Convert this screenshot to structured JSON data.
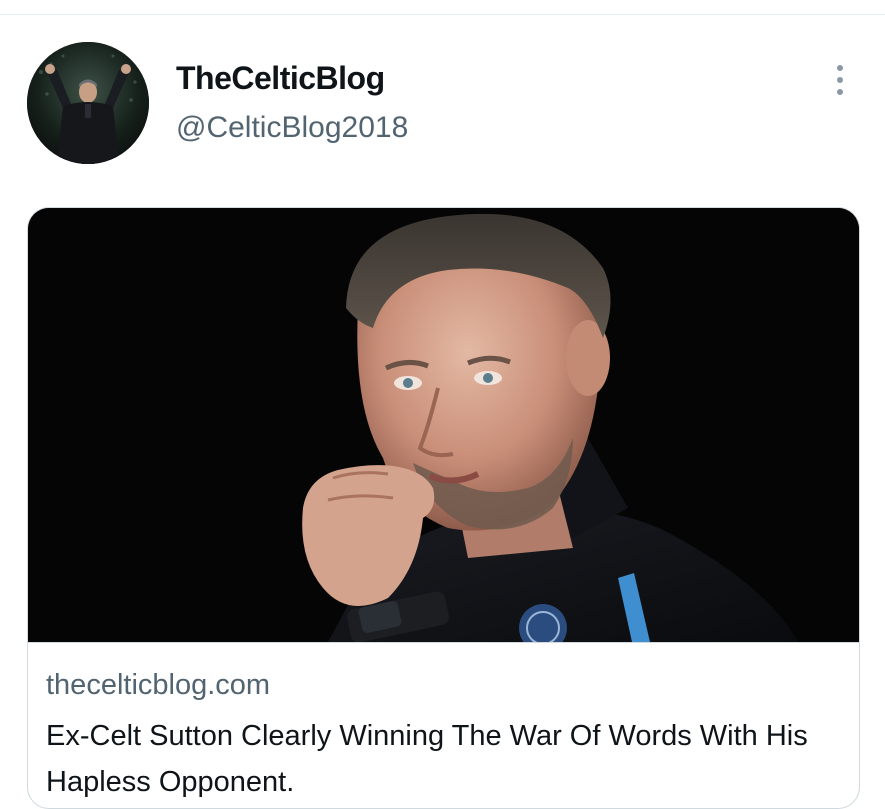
{
  "tweet": {
    "author": {
      "display_name": "TheCelticBlog",
      "handle": "@CelticBlog2018",
      "avatar_icon": "profile-photo-celebrating-manager"
    },
    "more_icon": "more-vertical-icon"
  },
  "link_card": {
    "image_description_icon": "article-photo",
    "domain": "thecelticblog.com",
    "title": "Ex-Celt Sutton Clearly Winning The War Of Words With His Hapless Opponent."
  },
  "colors": {
    "text_primary": "#0f1419",
    "text_secondary": "#536471",
    "border": "#cfd9de"
  }
}
